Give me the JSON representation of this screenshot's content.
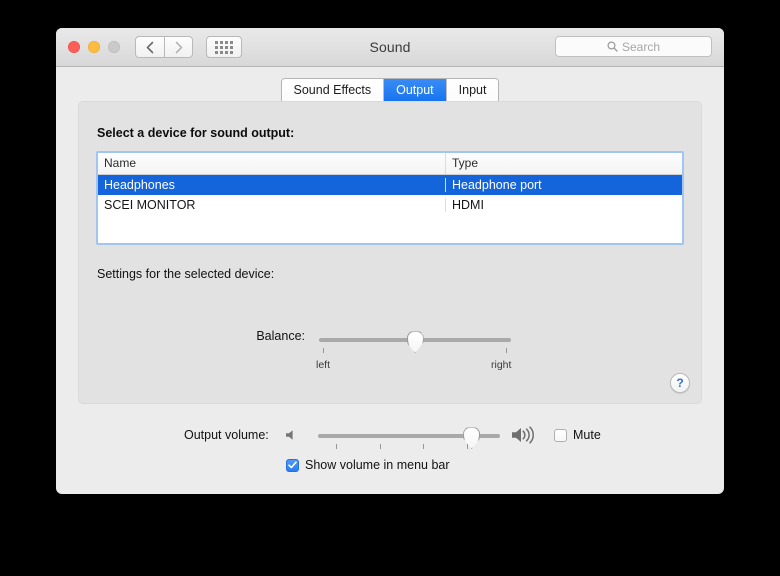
{
  "window": {
    "title": "Sound",
    "traffic_lights": [
      "close",
      "minimize",
      "zoom"
    ],
    "nav": {
      "back_icon": "chevron-left-icon",
      "forward_icon": "chevron-right-icon"
    },
    "show_all_icon": "grid-dots-icon"
  },
  "search": {
    "placeholder": "Search",
    "icon": "search-icon"
  },
  "tabs": [
    {
      "label": "Sound Effects",
      "selected": false
    },
    {
      "label": "Output",
      "selected": true
    },
    {
      "label": "Input",
      "selected": false
    }
  ],
  "panel": {
    "select_label": "Select a device for sound output:",
    "settings_label": "Settings for the selected device:",
    "help_label": "?",
    "help_icon": "question-mark-icon"
  },
  "device_table": {
    "columns": [
      "Name",
      "Type"
    ],
    "rows": [
      {
        "name": "Headphones",
        "type": "Headphone port",
        "selected": true
      },
      {
        "name": "SCEI MONITOR",
        "type": "HDMI",
        "selected": false
      }
    ]
  },
  "balance": {
    "label": "Balance:",
    "min_label": "left",
    "max_label": "right",
    "value_percent": 50
  },
  "output_volume": {
    "label": "Output volume:",
    "low_icon": "speaker-quiet-icon",
    "high_icon": "speaker-loud-icon",
    "value_percent": 88,
    "mute": {
      "label": "Mute",
      "checked": false
    },
    "menu_bar": {
      "label": "Show volume in menu bar",
      "checked": true
    }
  },
  "colors": {
    "accent_blue": "#1464dc",
    "tab_selected": "#1472ef",
    "focus_ring": "#9fc5f0",
    "window_bg": "#ececec",
    "panel_bg": "#e2e2e2"
  }
}
